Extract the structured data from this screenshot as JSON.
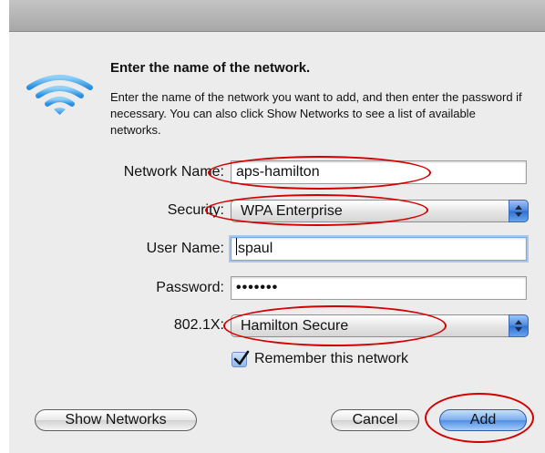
{
  "dialog": {
    "heading": "Enter the name of the network.",
    "description": "Enter the name of the network you want to add, and then enter the password if necessary. You can also click Show Networks to see a list of available networks."
  },
  "form": {
    "network_name_label": "Network Name:",
    "network_name_value": "aps-hamilton",
    "security_label": "Security:",
    "security_value": "WPA Enterprise",
    "user_name_label": "User Name:",
    "user_name_value": "spaul",
    "password_label": "Password:",
    "password_value": "•••••••",
    "eap_label": "802.1X:",
    "eap_value": "Hamilton Secure",
    "remember_label": "Remember this network",
    "remember_checked": true
  },
  "buttons": {
    "show_networks": "Show Networks",
    "cancel": "Cancel",
    "add": "Add"
  },
  "colors": {
    "sheet_bg": "#ececec",
    "annotation": "#d40000",
    "accent_blue": "#4f8fe6"
  },
  "icons": {
    "wifi": "wifi-icon",
    "select_arrows": "up-down-arrows-icon",
    "checkmark": "checkmark-icon"
  }
}
